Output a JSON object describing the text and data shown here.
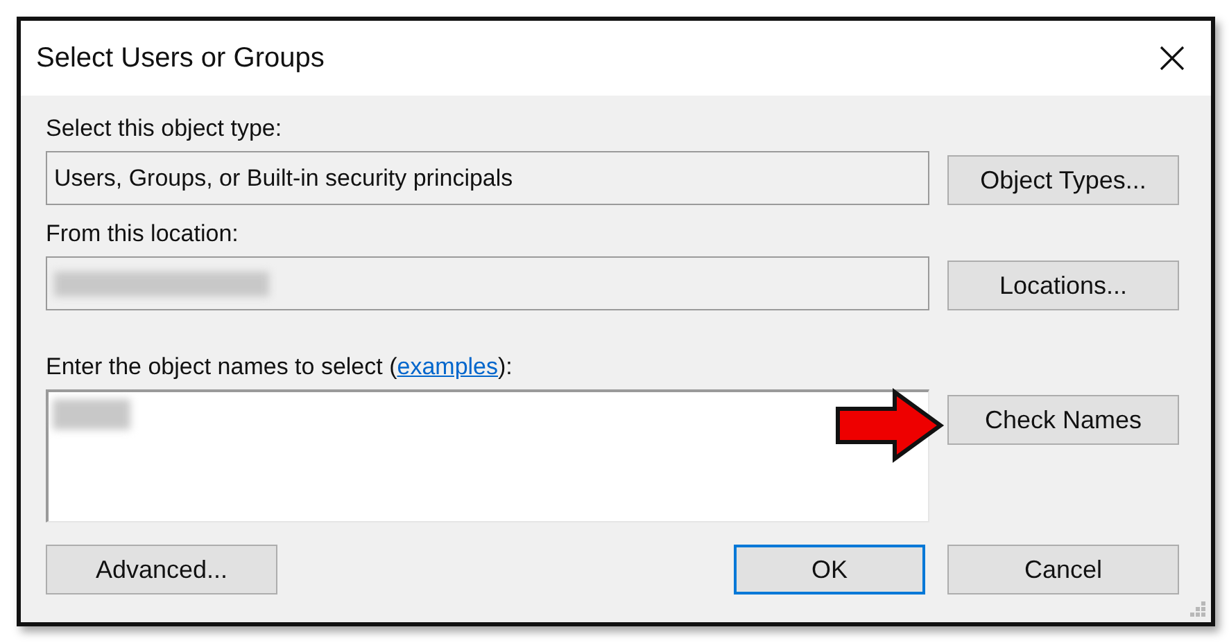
{
  "window": {
    "title": "Select Users or Groups"
  },
  "object_type": {
    "label": "Select this object type:",
    "value": "Users, Groups, or Built-in security principals",
    "button": "Object Types..."
  },
  "location": {
    "label": "From this location:",
    "button": "Locations..."
  },
  "names": {
    "label_before": "Enter the object names to select (",
    "link": "examples",
    "label_after": "):",
    "button": "Check Names"
  },
  "buttons": [
    {
      "label": "Advanced...",
      "kind": "left",
      "default": false
    },
    {
      "label": "OK",
      "kind": "right",
      "default": true
    },
    {
      "label": "Cancel",
      "kind": "right",
      "default": false
    }
  ]
}
